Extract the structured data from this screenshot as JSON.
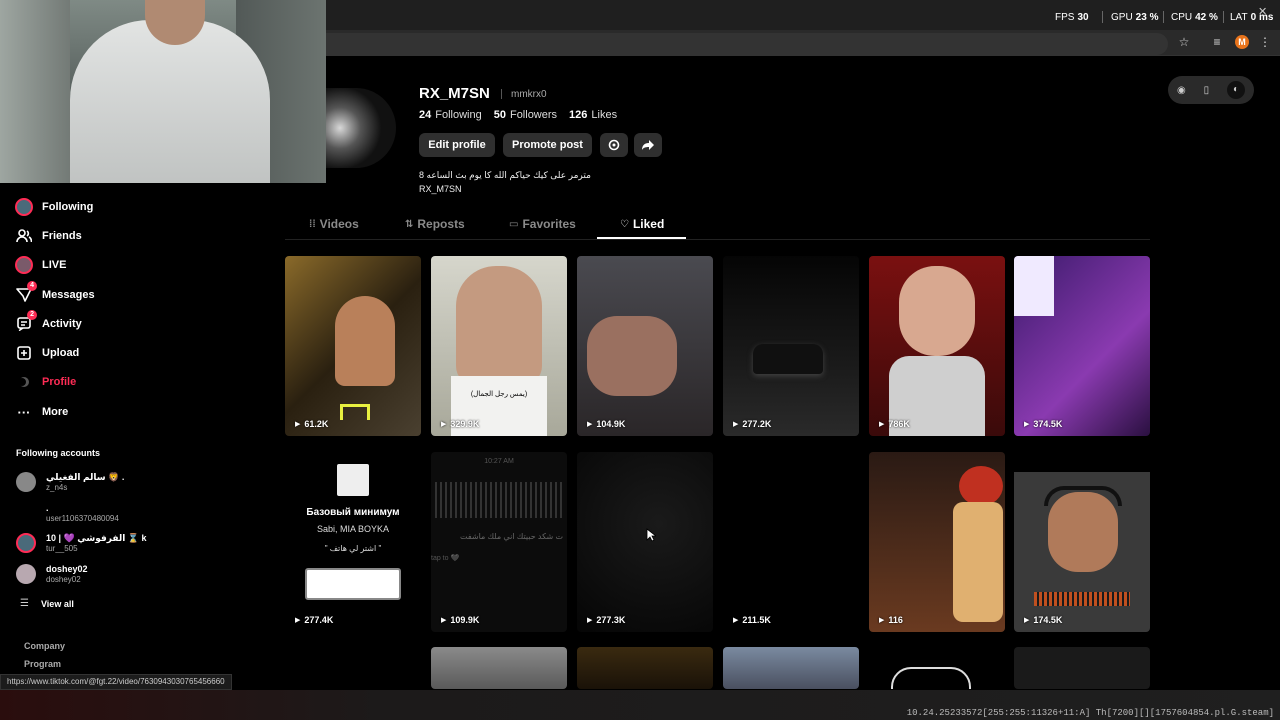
{
  "perf": {
    "fps_label": "FPS",
    "fps": "30",
    "gpu_label": "GPU",
    "gpu": "23 %",
    "cpu_label": "CPU",
    "cpu": "42 %",
    "lat_label": "LAT",
    "lat": "0 ms"
  },
  "browser": {
    "profile_initial": "M",
    "status_url": "https://www.tiktok.com/@fgt.22/video/7630943030765456660"
  },
  "sidebar": {
    "items": [
      {
        "label": "Following",
        "icon": "avatar-ring-icon"
      },
      {
        "label": "Friends",
        "icon": "friends-icon"
      },
      {
        "label": "LIVE",
        "icon": "live-icon"
      },
      {
        "label": "Messages",
        "icon": "messages-icon",
        "badge": "4"
      },
      {
        "label": "Activity",
        "icon": "activity-icon",
        "badge": "2"
      },
      {
        "label": "Upload",
        "icon": "upload-icon"
      },
      {
        "label": "Profile",
        "icon": "profile-icon"
      },
      {
        "label": "More",
        "icon": "more-icon"
      }
    ],
    "following_title": "Following accounts",
    "accounts": [
      {
        "name": "سالم الفغيلي 🦁 .",
        "user": "z_n4s"
      },
      {
        "name": ".",
        "user": "user1106370480094"
      },
      {
        "name": "10 | 💜 الفرفوشي ⌛ k",
        "user": "tur__505"
      },
      {
        "name": "doshey02",
        "user": "doshey02"
      }
    ],
    "view_all": "View all",
    "footer": [
      "Company",
      "Program"
    ]
  },
  "profile": {
    "username": "RX_M7SN",
    "handle": "mmkrx0",
    "following_count": "24",
    "following_label": "Following",
    "followers_count": "50",
    "followers_label": "Followers",
    "likes_count": "126",
    "likes_label": "Likes",
    "edit_button": "Edit profile",
    "promote_button": "Promote post",
    "bio_line1": "مترمر على كيك حياكم الله كا يوم بث الساعه 8",
    "bio_line2": "RX_M7SN"
  },
  "tabs": [
    {
      "label": "Videos",
      "icon": "grid-icon"
    },
    {
      "label": "Reposts",
      "icon": "repost-icon"
    },
    {
      "label": "Favorites",
      "icon": "bookmark-icon"
    },
    {
      "label": "Liked",
      "icon": "heart-icon"
    }
  ],
  "videos": [
    {
      "views": "61.2K",
      "kind": "streamer"
    },
    {
      "views": "329.9K",
      "kind": "portrait",
      "caption": "(يمس رجل الجمال)"
    },
    {
      "views": "104.9K",
      "kind": "hand"
    },
    {
      "views": "277.2K",
      "kind": "car"
    },
    {
      "views": "786K",
      "kind": "girl"
    },
    {
      "views": "374.5K",
      "kind": "purple"
    },
    {
      "views": "277.4K",
      "kind": "music",
      "song": "Базовый минимум",
      "artist": "Sabi, MIA BOYKA",
      "lyric": "\" اشتر لي هاتف \""
    },
    {
      "views": "109.9K",
      "kind": "voice",
      "time": "10:27 AM",
      "text": "ت شكد حبيتك اني ملك ماشفت",
      "tap": "tap to 🖤"
    },
    {
      "views": "277.3K",
      "kind": "dark"
    },
    {
      "views": "211.5K",
      "kind": "black"
    },
    {
      "views": "116",
      "kind": "anime"
    },
    {
      "views": "174.5K",
      "kind": "laugh"
    }
  ],
  "bottom_text": "10.24.25233572[255:255:11326+11:A] Th[7200][][1757604854.pl.G.steam]",
  "colors": {
    "accent": "#fe2c55",
    "bg": "#000000",
    "button": "#2f2f2f"
  }
}
